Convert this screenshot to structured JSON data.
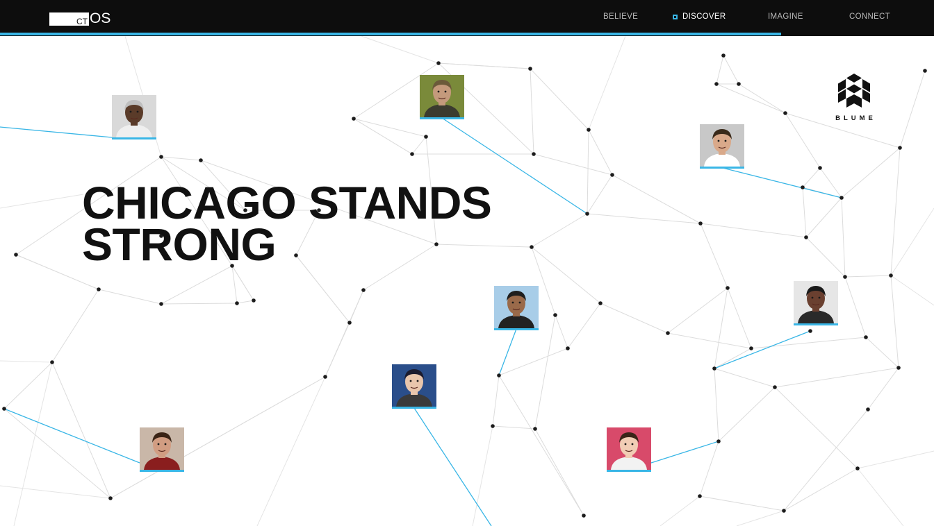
{
  "header": {
    "logo": {
      "ct": "CT",
      "os": "OS"
    },
    "nav": [
      {
        "label": "BELIEVE",
        "active": false
      },
      {
        "label": "DISCOVER",
        "active": true
      },
      {
        "label": "IMAGINE",
        "active": false
      },
      {
        "label": "CONNECT",
        "active": false
      }
    ],
    "accent_color": "#39b6e6"
  },
  "hero": {
    "line1": "CHICAGO STANDS",
    "line2": "STRONG"
  },
  "brand": {
    "name": "BLUME",
    "icon": "hexagon-cube-icon"
  },
  "people": [
    {
      "name": "person-older-man",
      "skin": "#5a3b29",
      "hair": "#bfbfbf",
      "bg": "#d9d9d9",
      "shirt": "#efefef"
    },
    {
      "name": "person-hooded-man",
      "skin": "#c49a7c",
      "hair": "#6b5a3a",
      "bg": "#7a8a3a",
      "shirt": "#3b3b2f"
    },
    {
      "name": "person-man-glasses",
      "skin": "#d9a98a",
      "hair": "#3a2a1a",
      "bg": "#c8c8c8",
      "shirt": "#ffffff"
    },
    {
      "name": "person-man-sunglasses",
      "skin": "#9a6a4a",
      "hair": "#1e1e1e",
      "bg": "#a8cde8",
      "shirt": "#222222"
    },
    {
      "name": "person-woman-smiling",
      "skin": "#6a4030",
      "hair": "#1a1a1a",
      "bg": "#e6e6e6",
      "shirt": "#2a2a2a"
    },
    {
      "name": "person-woman-bangs",
      "skin": "#e9c6ac",
      "hair": "#1b1b2e",
      "bg": "#2a4e8a",
      "shirt": "#3a3a3a"
    },
    {
      "name": "person-young-man",
      "skin": "#d19d82",
      "hair": "#3a2416",
      "bg": "#c9b7a8",
      "shirt": "#8a1e1e"
    },
    {
      "name": "person-asian-woman",
      "skin": "#f1cdb5",
      "hair": "#3a2418",
      "bg": "#d84a6a",
      "shirt": "#f2f2f2"
    }
  ]
}
